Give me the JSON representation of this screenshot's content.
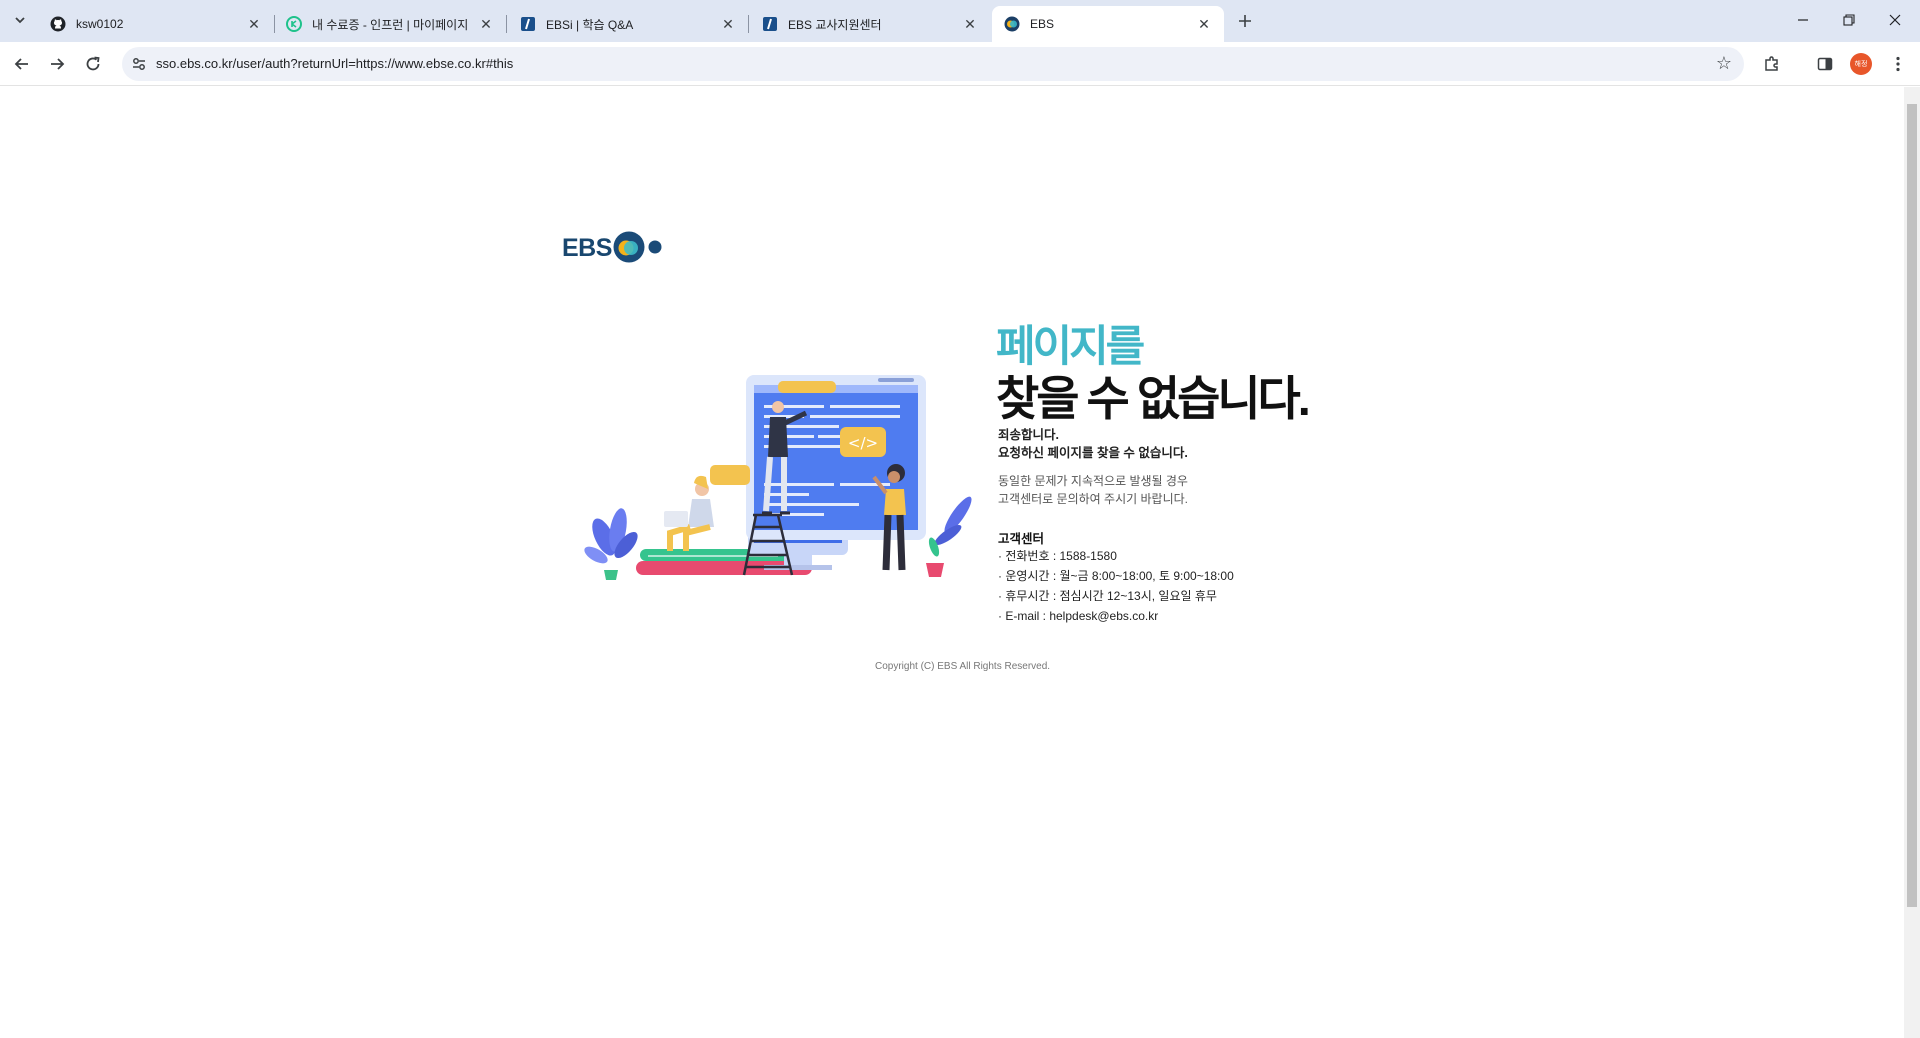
{
  "browser": {
    "tabs": [
      {
        "title": "ksw0102",
        "favicon": "github-icon",
        "active": false
      },
      {
        "title": "내 수료증 - 인프런 | 마이페이지",
        "favicon": "inflearn-icon",
        "active": false
      },
      {
        "title": "EBSi | 학습 Q&A",
        "favicon": "ebsi-icon",
        "active": false
      },
      {
        "title": "EBS 교사지원센터",
        "favicon": "ebsi-icon",
        "active": false
      },
      {
        "title": "EBS",
        "favicon": "ebs-icon",
        "active": true
      }
    ],
    "address_bar": {
      "url": "sso.ebs.co.kr/user/auth?returnUrl=https://www.ebse.co.kr#this"
    },
    "profile_label": "해정"
  },
  "page": {
    "logo_text": "EBS",
    "headline_line1": "페이지를",
    "headline_line2": "찾을 수 없습니다.",
    "apology": "죄송합니다.",
    "not_found_message": "요청하신 페이지를 찾을 수 없습니다.",
    "guidance_line1": "동일한 문제가 지속적으로 발생될 경우",
    "guidance_line2": "고객센터로 문의하여 주시기 바랍니다.",
    "customer_center": {
      "title": "고객센터",
      "items": [
        "· 전화번호 : 1588-1580",
        "· 운영시간 : 월~금 8:00~18:00, 토 9:00~18:00",
        "· 휴무시간 : 점심시간 12~13시, 일요일 휴무",
        "· E-mail : helpdesk@ebs.co.kr"
      ]
    },
    "copyright": "Copyright (C) EBS All Rights Reserved."
  },
  "colors": {
    "headline_accent": "#42b7c8",
    "logo_navy": "#19476f",
    "tabstrip_bg": "#dfe6f3"
  }
}
